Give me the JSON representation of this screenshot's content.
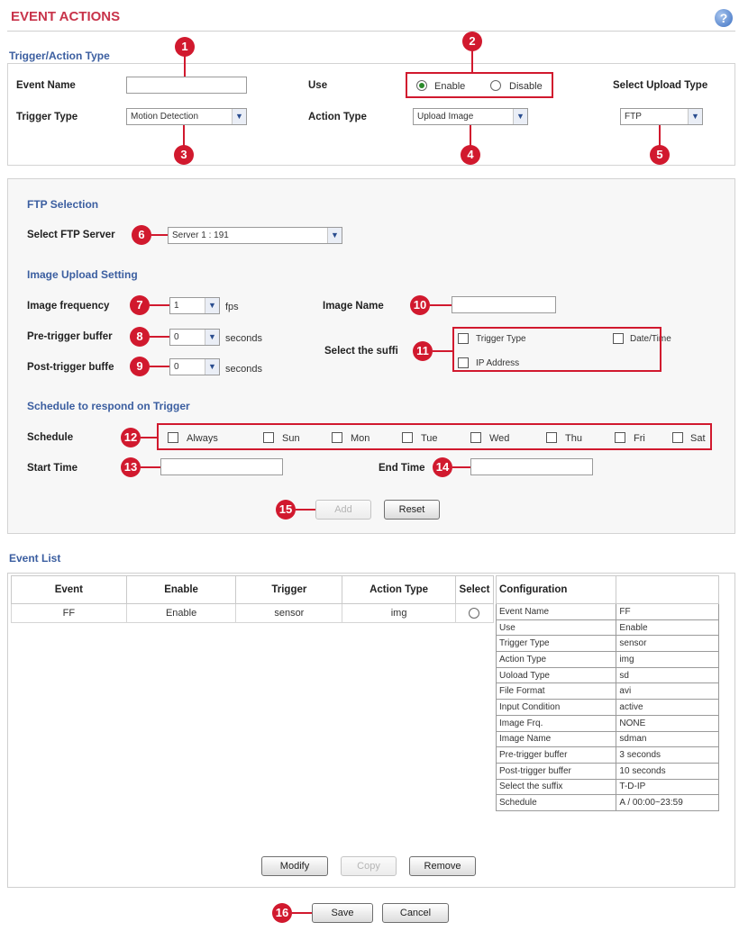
{
  "header": {
    "title": "EVENT ACTIONS",
    "help_icon": "?"
  },
  "colors": {
    "accent_red": "#d1192e",
    "title_red": "#c8334a",
    "section_blue": "#3b5ea0"
  },
  "markers": [
    "1",
    "2",
    "3",
    "4",
    "5",
    "6",
    "7",
    "8",
    "9",
    "10",
    "11",
    "12",
    "13",
    "14",
    "15",
    "16"
  ],
  "trigger": {
    "heading": "Trigger/Action Type",
    "event_name_label": "Event Name",
    "event_name_value": "",
    "use_label": "Use",
    "enable_label": "Enable",
    "disable_label": "Disable",
    "use_selected": "Enable",
    "upload_type_label": "Select Upload Type",
    "trigger_type_label": "Trigger Type",
    "trigger_type_value": "Motion Detection",
    "action_type_label": "Action Type",
    "action_type_value": "Upload Image",
    "upload_type_value": "FTP"
  },
  "ftp": {
    "heading": "FTP Selection",
    "server_label": "Select FTP Server",
    "server_value": "Server 1 : 191"
  },
  "image": {
    "heading": "Image Upload Setting",
    "frequency_label": "Image frequency",
    "frequency_value": "1",
    "fps_unit": "fps",
    "pre_label": "Pre-trigger buffer",
    "pre_value": "0",
    "post_label": "Post-trigger buffe",
    "post_value": "0",
    "seconds_unit": "seconds",
    "name_label": "Image Name",
    "name_value": "",
    "suffix_label": "Select the suffi",
    "suffix_trigger": "Trigger Type",
    "suffix_datetime": "Date/Time",
    "suffix_ip": "IP Address"
  },
  "schedule": {
    "heading": "Schedule to respond on Trigger",
    "label": "Schedule",
    "days": [
      "Always",
      "Sun",
      "Mon",
      "Tue",
      "Wed",
      "Thu",
      "Fri",
      "Sat"
    ],
    "start_label": "Start Time",
    "end_label": "End Time",
    "start_value": "",
    "end_value": ""
  },
  "form_buttons": {
    "add": "Add",
    "reset": "Reset"
  },
  "event_list": {
    "heading": "Event List",
    "columns": [
      "Event",
      "Enable",
      "Trigger",
      "Action Type",
      "Select"
    ],
    "rows": [
      {
        "event": "FF",
        "enable": "Enable",
        "trigger": "sensor",
        "action": "img"
      }
    ],
    "config_header": "Configuration",
    "config": [
      [
        "Event Name",
        "FF"
      ],
      [
        "Use",
        "Enable"
      ],
      [
        "Trigger Type",
        "sensor"
      ],
      [
        "Action Type",
        "img"
      ],
      [
        "Uoload Type",
        "sd"
      ],
      [
        "File Format",
        "avi"
      ],
      [
        "Input Condition",
        "active"
      ],
      [
        "Image Frq.",
        "NONE"
      ],
      [
        "Image Name",
        "sdman"
      ],
      [
        "Pre-trigger buffer",
        "3 seconds"
      ],
      [
        "Post-trigger buffer",
        "10 seconds"
      ],
      [
        "Select the suffix",
        "T-D-IP"
      ],
      [
        "Schedule",
        "A / 00:00~23:59"
      ]
    ],
    "buttons": {
      "modify": "Modify",
      "copy": "Copy",
      "remove": "Remove"
    }
  },
  "footer": {
    "save": "Save",
    "cancel": "Cancel"
  }
}
